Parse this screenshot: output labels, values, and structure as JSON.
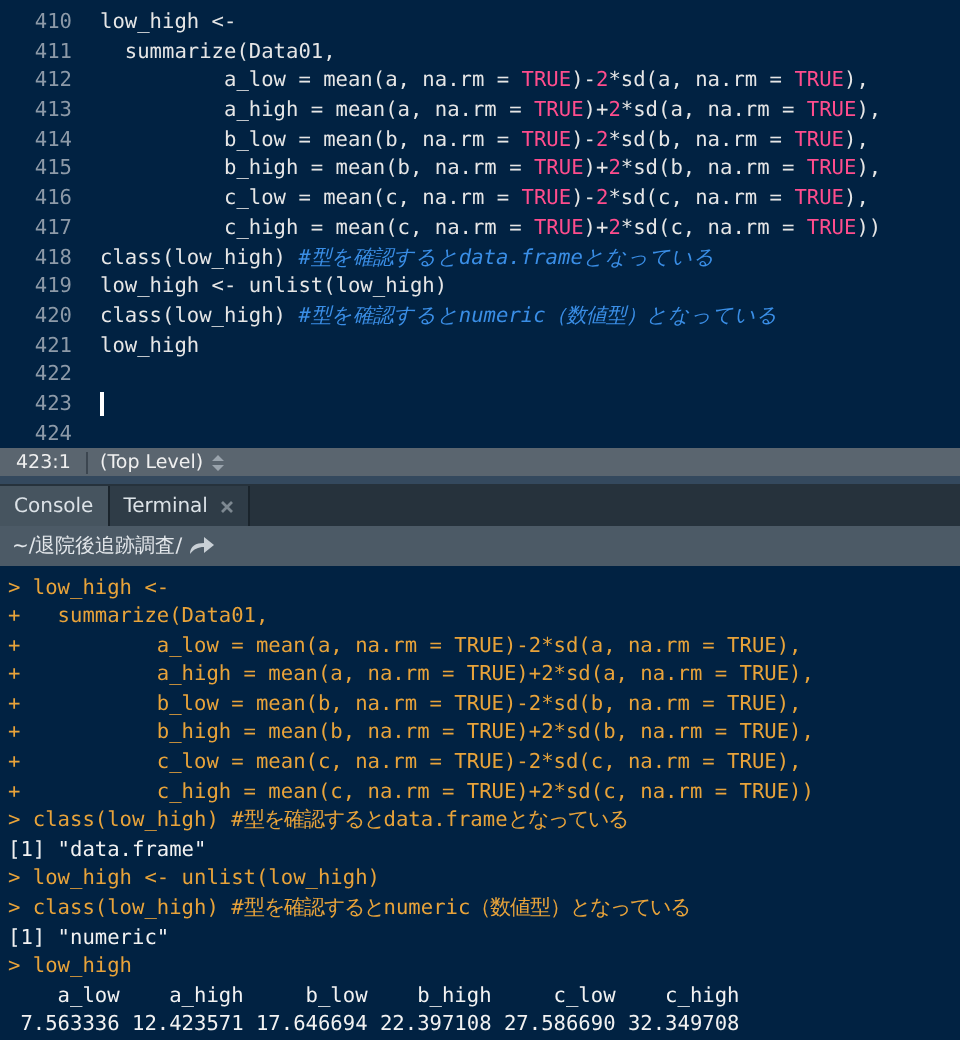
{
  "editor": {
    "lines": [
      {
        "number": "410",
        "cursor": false,
        "segments": [
          {
            "kind": "code",
            "text": "low_high <-"
          }
        ]
      },
      {
        "number": "411",
        "cursor": false,
        "segments": [
          {
            "kind": "code",
            "text": "  summarize(Data01,"
          }
        ]
      },
      {
        "number": "412",
        "cursor": false,
        "segments": [
          {
            "kind": "code",
            "text": "          a_low = mean(a, na.rm = "
          },
          {
            "kind": "const",
            "text": "TRUE"
          },
          {
            "kind": "code",
            "text": ")-"
          },
          {
            "kind": "const",
            "text": "2"
          },
          {
            "kind": "code",
            "text": "*sd(a, na.rm = "
          },
          {
            "kind": "const",
            "text": "TRUE"
          },
          {
            "kind": "code",
            "text": "),"
          }
        ]
      },
      {
        "number": "413",
        "cursor": false,
        "segments": [
          {
            "kind": "code",
            "text": "          a_high = mean(a, na.rm = "
          },
          {
            "kind": "const",
            "text": "TRUE"
          },
          {
            "kind": "code",
            "text": ")+"
          },
          {
            "kind": "const",
            "text": "2"
          },
          {
            "kind": "code",
            "text": "*sd(a, na.rm = "
          },
          {
            "kind": "const",
            "text": "TRUE"
          },
          {
            "kind": "code",
            "text": "),"
          }
        ]
      },
      {
        "number": "414",
        "cursor": false,
        "segments": [
          {
            "kind": "code",
            "text": "          b_low = mean(b, na.rm = "
          },
          {
            "kind": "const",
            "text": "TRUE"
          },
          {
            "kind": "code",
            "text": ")-"
          },
          {
            "kind": "const",
            "text": "2"
          },
          {
            "kind": "code",
            "text": "*sd(b, na.rm = "
          },
          {
            "kind": "const",
            "text": "TRUE"
          },
          {
            "kind": "code",
            "text": "),"
          }
        ]
      },
      {
        "number": "415",
        "cursor": false,
        "segments": [
          {
            "kind": "code",
            "text": "          b_high = mean(b, na.rm = "
          },
          {
            "kind": "const",
            "text": "TRUE"
          },
          {
            "kind": "code",
            "text": ")+"
          },
          {
            "kind": "const",
            "text": "2"
          },
          {
            "kind": "code",
            "text": "*sd(b, na.rm = "
          },
          {
            "kind": "const",
            "text": "TRUE"
          },
          {
            "kind": "code",
            "text": "),"
          }
        ]
      },
      {
        "number": "416",
        "cursor": false,
        "segments": [
          {
            "kind": "code",
            "text": "          c_low = mean(c, na.rm = "
          },
          {
            "kind": "const",
            "text": "TRUE"
          },
          {
            "kind": "code",
            "text": ")-"
          },
          {
            "kind": "const",
            "text": "2"
          },
          {
            "kind": "code",
            "text": "*sd(c, na.rm = "
          },
          {
            "kind": "const",
            "text": "TRUE"
          },
          {
            "kind": "code",
            "text": "),"
          }
        ]
      },
      {
        "number": "417",
        "cursor": false,
        "segments": [
          {
            "kind": "code",
            "text": "          c_high = mean(c, na.rm = "
          },
          {
            "kind": "const",
            "text": "TRUE"
          },
          {
            "kind": "code",
            "text": ")+"
          },
          {
            "kind": "const",
            "text": "2"
          },
          {
            "kind": "code",
            "text": "*sd(c, na.rm = "
          },
          {
            "kind": "const",
            "text": "TRUE"
          },
          {
            "kind": "code",
            "text": "))"
          }
        ]
      },
      {
        "number": "418",
        "cursor": false,
        "segments": [
          {
            "kind": "code",
            "text": "class(low_high) "
          },
          {
            "kind": "comment",
            "text": "#型を確認するとdata.frameとなっている"
          }
        ]
      },
      {
        "number": "419",
        "cursor": false,
        "segments": [
          {
            "kind": "code",
            "text": "low_high <- unlist(low_high)"
          }
        ]
      },
      {
        "number": "420",
        "cursor": false,
        "segments": [
          {
            "kind": "code",
            "text": "class(low_high) "
          },
          {
            "kind": "comment",
            "text": "#型を確認するとnumeric（数値型）となっている"
          }
        ]
      },
      {
        "number": "421",
        "cursor": false,
        "segments": [
          {
            "kind": "code",
            "text": "low_high"
          }
        ]
      },
      {
        "number": "422",
        "cursor": false
      },
      {
        "number": "423",
        "cursor": true
      },
      {
        "number": "424",
        "cursor": false
      }
    ]
  },
  "status_bar": {
    "position": "423:1",
    "scope": "(Top Level)"
  },
  "tabs": [
    {
      "label": "Console",
      "selected": true,
      "closable": false
    },
    {
      "label": "Terminal",
      "selected": false,
      "closable": true
    }
  ],
  "path": "~/退院後追跡調査/",
  "console": [
    {
      "kind": "input",
      "text": "> low_high <-"
    },
    {
      "kind": "input",
      "text": "+   summarize(Data01,"
    },
    {
      "kind": "input",
      "text": "+           a_low = mean(a, na.rm = TRUE)-2*sd(a, na.rm = TRUE),"
    },
    {
      "kind": "input",
      "text": "+           a_high = mean(a, na.rm = TRUE)+2*sd(a, na.rm = TRUE),"
    },
    {
      "kind": "input",
      "text": "+           b_low = mean(b, na.rm = TRUE)-2*sd(b, na.rm = TRUE),"
    },
    {
      "kind": "input",
      "text": "+           b_high = mean(b, na.rm = TRUE)+2*sd(b, na.rm = TRUE),"
    },
    {
      "kind": "input",
      "text": "+           c_low = mean(c, na.rm = TRUE)-2*sd(c, na.rm = TRUE),"
    },
    {
      "kind": "input",
      "text": "+           c_high = mean(c, na.rm = TRUE)+2*sd(c, na.rm = TRUE))"
    },
    {
      "kind": "input",
      "text": "> class(low_high) #型を確認するとdata.frameとなっている"
    },
    {
      "kind": "output",
      "text": "[1] \"data.frame\""
    },
    {
      "kind": "input",
      "text": "> low_high <- unlist(low_high)"
    },
    {
      "kind": "input",
      "text": "> class(low_high) #型を確認するとnumeric（数値型）となっている"
    },
    {
      "kind": "output",
      "text": "[1] \"numeric\""
    },
    {
      "kind": "input",
      "text": "> low_high"
    },
    {
      "kind": "output",
      "text": "    a_low    a_high     b_low    b_high     c_low    c_high "
    },
    {
      "kind": "output",
      "text": " 7.563336 12.423571 17.646694 22.397108 27.586690 32.349708 "
    }
  ]
}
